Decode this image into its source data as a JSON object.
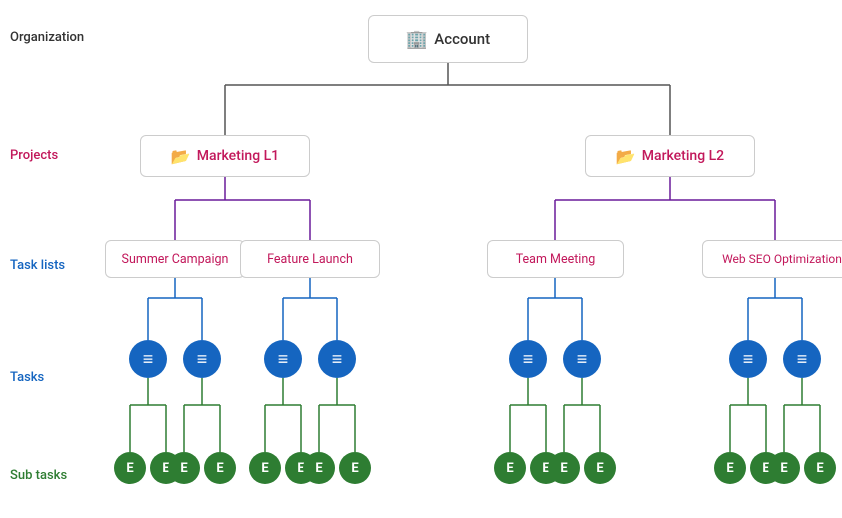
{
  "labels": {
    "organization": "Organization",
    "projects": "Projects",
    "task_lists": "Task lists",
    "tasks": "Tasks",
    "sub_tasks": "Sub tasks"
  },
  "account": {
    "label": "Account",
    "icon": "🏢"
  },
  "projects": [
    {
      "id": "ml1",
      "label": "Marketing L1",
      "icon": "📂"
    },
    {
      "id": "ml2",
      "label": "Marketing L2",
      "icon": "📂"
    }
  ],
  "task_lists": [
    {
      "id": "sc",
      "label": "Summer Campaign"
    },
    {
      "id": "fl",
      "label": "Feature Launch"
    },
    {
      "id": "tm",
      "label": "Team Meeting"
    },
    {
      "id": "ws",
      "label": "Web SEO Optimization"
    }
  ],
  "colors": {
    "account_border": "#888",
    "project_line": "#6a1b9a",
    "tasklist_line": "#1565c0",
    "task_circle": "#1565c0",
    "subtask_circle": "#2e7d32",
    "subtask_line": "#2e7d32",
    "connector": "#555"
  },
  "icons": {
    "task": "≡",
    "subtask": "E"
  }
}
